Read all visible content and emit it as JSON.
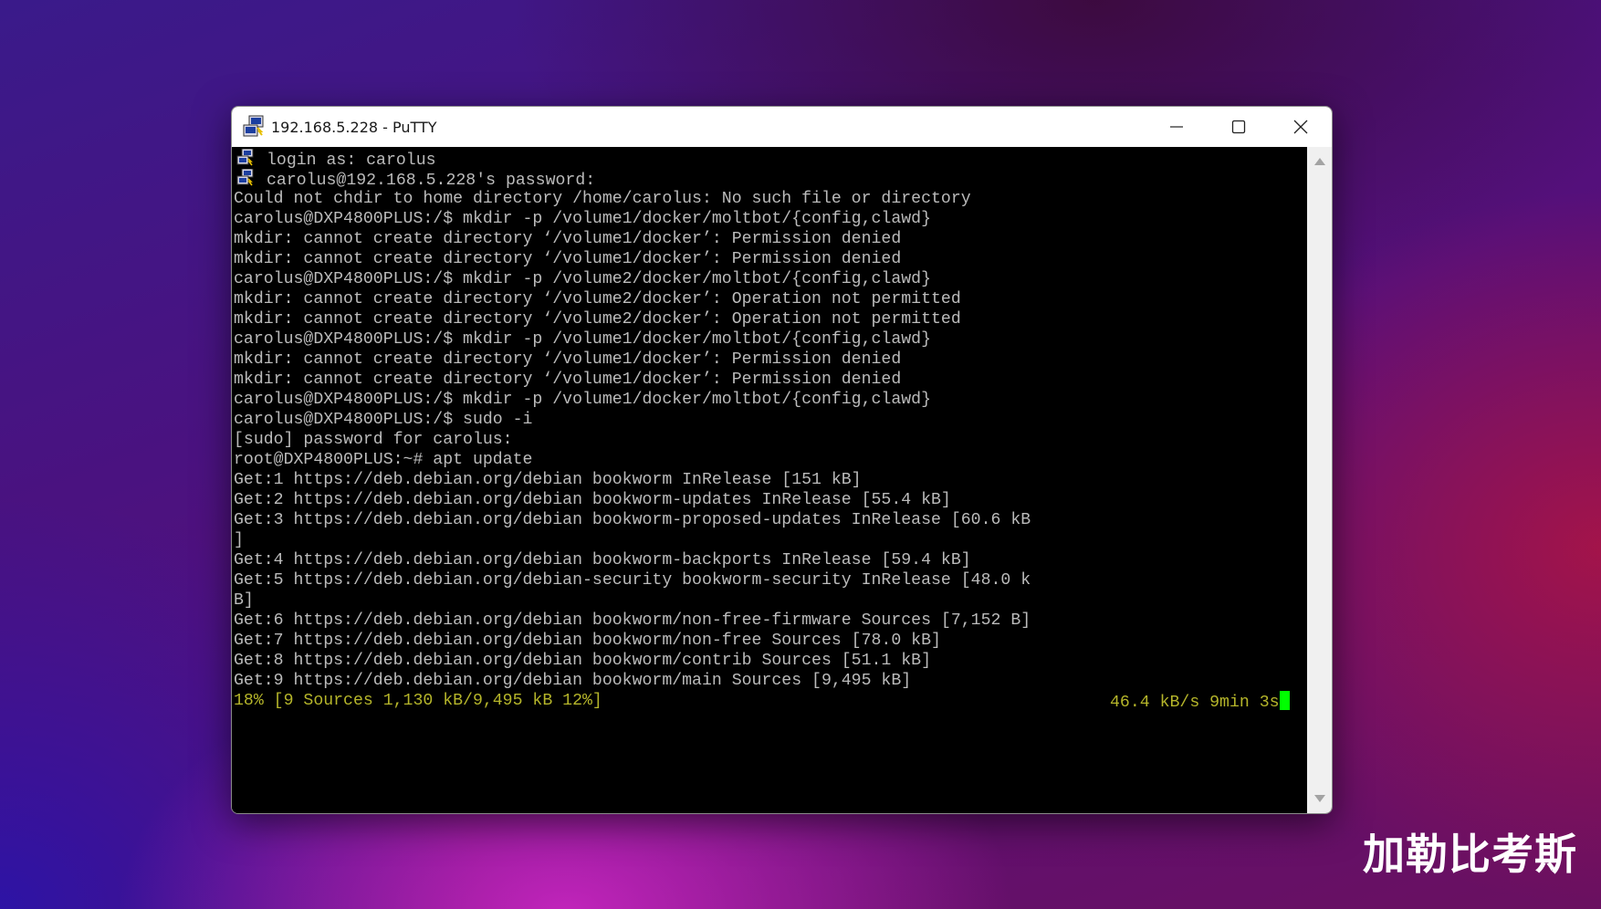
{
  "window": {
    "title": "192.168.5.228 - PuTTY",
    "app_icon": "putty-icon",
    "controls": {
      "minimize_icon": "minimize-icon",
      "maximize_icon": "maximize-icon",
      "close_icon": "close-icon"
    }
  },
  "terminal": {
    "lines": [
      {
        "icon": "putty-icon",
        "text": "login as: carolus"
      },
      {
        "icon": "putty-icon",
        "text": "carolus@192.168.5.228's password:"
      },
      {
        "text": "Could not chdir to home directory /home/carolus: No such file or directory"
      },
      {
        "text": "carolus@DXP4800PLUS:/$ mkdir -p /volume1/docker/moltbot/{config,clawd}"
      },
      {
        "text": "mkdir: cannot create directory ‘/volume1/docker’: Permission denied"
      },
      {
        "text": "mkdir: cannot create directory ‘/volume1/docker’: Permission denied"
      },
      {
        "text": "carolus@DXP4800PLUS:/$ mkdir -p /volume2/docker/moltbot/{config,clawd}"
      },
      {
        "text": "mkdir: cannot create directory ‘/volume2/docker’: Operation not permitted"
      },
      {
        "text": "mkdir: cannot create directory ‘/volume2/docker’: Operation not permitted"
      },
      {
        "text": "carolus@DXP4800PLUS:/$ mkdir -p /volume1/docker/moltbot/{config,clawd}"
      },
      {
        "text": "mkdir: cannot create directory ‘/volume1/docker’: Permission denied"
      },
      {
        "text": "mkdir: cannot create directory ‘/volume1/docker’: Permission denied"
      },
      {
        "text": "carolus@DXP4800PLUS:/$ mkdir -p /volume1/docker/moltbot/{config,clawd}"
      },
      {
        "text": "carolus@DXP4800PLUS:/$ sudo -i"
      },
      {
        "text": "[sudo] password for carolus:"
      },
      {
        "text": "root@DXP4800PLUS:~# apt update"
      },
      {
        "text": "Get:1 https://deb.debian.org/debian bookworm InRelease [151 kB]"
      },
      {
        "text": "Get:2 https://deb.debian.org/debian bookworm-updates InRelease [55.4 kB]"
      },
      {
        "text": "Get:3 https://deb.debian.org/debian bookworm-proposed-updates InRelease [60.6 kB"
      },
      {
        "text": "]"
      },
      {
        "text": "Get:4 https://deb.debian.org/debian bookworm-backports InRelease [59.4 kB]"
      },
      {
        "text": "Get:5 https://deb.debian.org/debian-security bookworm-security InRelease [48.0 k"
      },
      {
        "text": "B]"
      },
      {
        "text": "Get:6 https://deb.debian.org/debian bookworm/non-free-firmware Sources [7,152 B]"
      },
      {
        "text": "Get:7 https://deb.debian.org/debian bookworm/non-free Sources [78.0 kB]"
      },
      {
        "text": "Get:8 https://deb.debian.org/debian bookworm/contrib Sources [51.1 kB]"
      },
      {
        "text": "Get:9 https://deb.debian.org/debian bookworm/main Sources [9,495 kB]"
      }
    ],
    "status_line": {
      "left": "18% [9 Sources 1,130 kB/9,495 kB 12%]",
      "right": "46.4 kB/s 9min 3s"
    },
    "colors": {
      "background": "#000000",
      "text": "#bbbbbb",
      "status_text": "#b5b52a",
      "cursor": "#00ff00"
    }
  },
  "watermark": "加勒比考斯"
}
